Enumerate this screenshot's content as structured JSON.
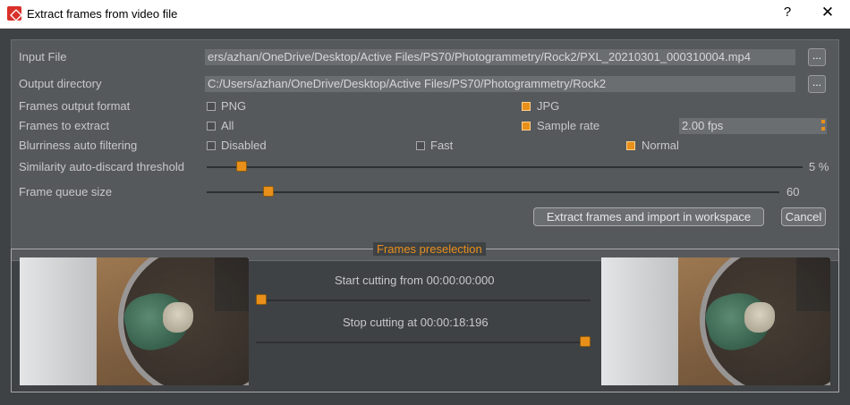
{
  "window": {
    "title": "Extract frames from video file",
    "help_label": "?",
    "close_label": "✕",
    "icon": "app-logo-icon"
  },
  "form": {
    "input_file": {
      "label": "Input File",
      "value": "ers/azhan/OneDrive/Desktop/Active Files/PS70/Photogrammetry/Rock2/PXL_20210301_000310004.mp4",
      "browse_label": "..."
    },
    "output_directory": {
      "label": "Output directory",
      "value": "C:/Users/azhan/OneDrive/Desktop/Active Files/PS70/Photogrammetry/Rock2",
      "browse_label": "..."
    },
    "output_format": {
      "label": "Frames output format",
      "options": [
        {
          "label": "PNG",
          "checked": false
        },
        {
          "label": "JPG",
          "checked": true
        }
      ]
    },
    "frames_to_extract": {
      "label": "Frames to extract",
      "options": [
        {
          "label": "All",
          "checked": false
        },
        {
          "label": "Sample rate",
          "checked": true
        }
      ],
      "sample_rate_value": "2.00 fps"
    },
    "blurriness": {
      "label": "Blurriness auto filtering",
      "options": [
        {
          "label": "Disabled",
          "checked": false
        },
        {
          "label": "Fast",
          "checked": false
        },
        {
          "label": "Normal",
          "checked": true
        }
      ]
    },
    "similarity": {
      "label": "Similarity auto-discard threshold",
      "value_text": "5 %",
      "level": 0.05
    },
    "frame_queue": {
      "label": "Frame queue size",
      "value_text": "60",
      "level": 0.1
    },
    "buttons": {
      "extract_label": "Extract frames and import in workspace",
      "cancel_label": "Cancel"
    }
  },
  "preselection": {
    "title": "Frames preselection",
    "start_label": "Start cutting from 00:00:00:000",
    "start_level": 0.0,
    "stop_label": "Stop cutting at 00:00:18:196",
    "stop_level": 1.0
  },
  "colors": {
    "accent": "#e8901a",
    "panel": "#56595c",
    "background": "#3f4245"
  }
}
